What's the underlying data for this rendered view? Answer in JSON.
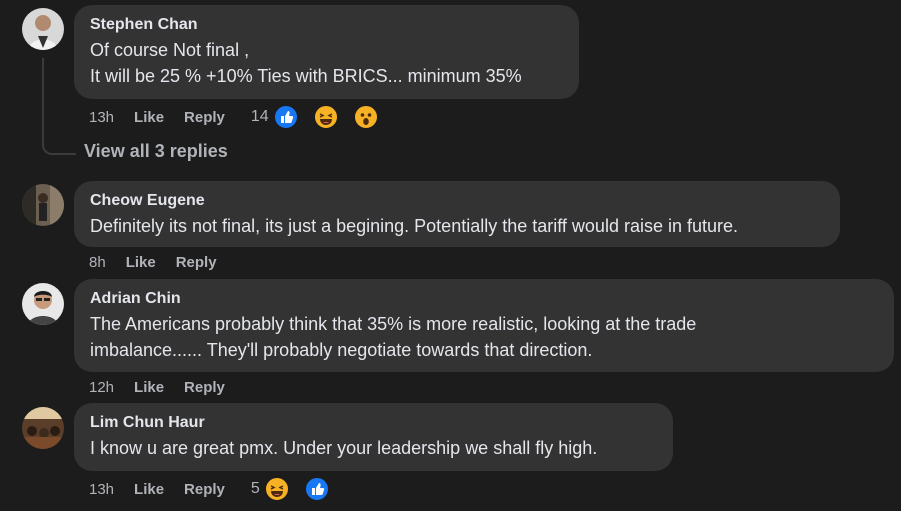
{
  "comments": [
    {
      "author": "Stephen Chan",
      "lines": [
        "Of course Not final ,",
        "It will be 25 % +10% Ties with BRICS... minimum 35%"
      ],
      "time": "13h",
      "like": "Like",
      "reply": "Reply",
      "reaction_count": "14",
      "reactions": [
        "like-icon",
        "haha-icon",
        "wow-icon"
      ]
    },
    {
      "author": "Cheow Eugene",
      "lines": [
        "Definitely its not final, its just a begining. Potentially the tariff would raise in future."
      ],
      "time": "8h",
      "like": "Like",
      "reply": "Reply"
    },
    {
      "author": "Adrian Chin",
      "lines": [
        "The Americans probably think that 35% is more realistic, looking at the trade",
        "imbalance...... They'll probably negotiate towards that direction."
      ],
      "time": "12h",
      "like": "Like",
      "reply": "Reply"
    },
    {
      "author": "Lim Chun Haur",
      "lines": [
        "I know u are great pmx. Under your leadership we shall fly high."
      ],
      "time": "13h",
      "like": "Like",
      "reply": "Reply",
      "reaction_count": "5",
      "reactions": [
        "haha-icon",
        "like-icon"
      ]
    }
  ],
  "view_replies": "View all 3 replies",
  "colors": {
    "background": "#1c1c1d",
    "bubble": "#333334",
    "text": "#e4e6eb",
    "muted": "#b0b3b8",
    "like_blue": "#1877f2",
    "emoji_yellow": "#f7b125"
  }
}
